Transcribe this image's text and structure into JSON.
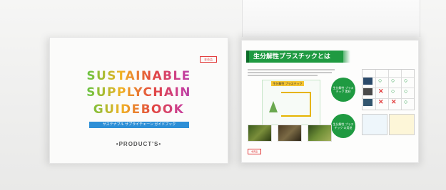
{
  "cover": {
    "stamp_text": "非売品",
    "title_lines": [
      "SUSTAINABLE",
      "SUPPLYCHAIN",
      "GUIDEBOOK"
    ],
    "subtitle": "サステナブル サプライチェーン ガイドブック",
    "brand": "•PRODUCT'S•",
    "gradient_colors": [
      "#2ca8d9",
      "#6fc23f",
      "#f0b323",
      "#e2463f",
      "#c83e9c",
      "#3f6fd8"
    ]
  },
  "spread": {
    "heading": "生分解性プラスチックとは",
    "diagram_label": "生分解性 プラスチック",
    "circle_top": "生分解性 プラスチック 素材",
    "circle_bottom": "生分解性 プラスチック の用途",
    "bottom_tag": "非売品",
    "accent_color": "#1f9a41",
    "marks": [
      [
        "o",
        "o",
        "o"
      ],
      [
        "x",
        "o",
        "o"
      ],
      [
        "x",
        "x",
        "o"
      ]
    ]
  }
}
